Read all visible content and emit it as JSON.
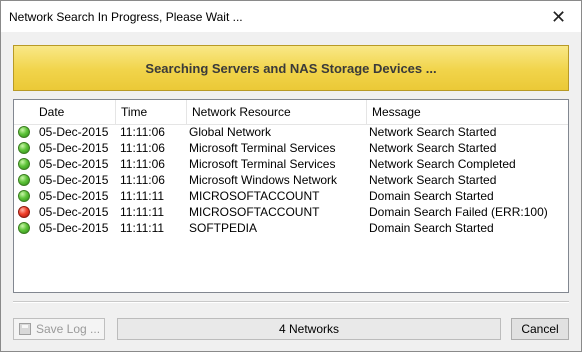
{
  "window": {
    "title": "Network Search In Progress, Please Wait ...",
    "close_glyph": "✕"
  },
  "banner": {
    "text": "Searching Servers and NAS Storage Devices ..."
  },
  "table": {
    "headers": [
      "Date",
      "Time",
      "Network Resource",
      "Message"
    ],
    "rows": [
      {
        "status": "green",
        "date": "05-Dec-2015",
        "time": "11:11:06",
        "resource": "Global Network",
        "message": "Network Search Started"
      },
      {
        "status": "green",
        "date": "05-Dec-2015",
        "time": "11:11:06",
        "resource": "Microsoft Terminal Services",
        "message": "Network Search Started"
      },
      {
        "status": "green",
        "date": "05-Dec-2015",
        "time": "11:11:06",
        "resource": "Microsoft Terminal Services",
        "message": "Network Search Completed"
      },
      {
        "status": "green",
        "date": "05-Dec-2015",
        "time": "11:11:06",
        "resource": "Microsoft Windows Network",
        "message": "Network Search Started"
      },
      {
        "status": "green",
        "date": "05-Dec-2015",
        "time": "11:11:11",
        "resource": "MICROSOFTACCOUNT",
        "message": "Domain Search Started"
      },
      {
        "status": "red",
        "date": "05-Dec-2015",
        "time": "11:11:11",
        "resource": "MICROSOFTACCOUNT",
        "message": "Domain Search Failed (ERR:100)"
      },
      {
        "status": "green",
        "date": "05-Dec-2015",
        "time": "11:11:11",
        "resource": "SOFTPEDIA",
        "message": "Domain Search Started"
      }
    ]
  },
  "footer": {
    "save_label": "Save Log ...",
    "status_text": "4 Networks",
    "cancel_label": "Cancel"
  },
  "colors": {
    "banner": "#f1d44a",
    "ok_dot": "#5fc43a",
    "error_dot": "#f0402a"
  }
}
